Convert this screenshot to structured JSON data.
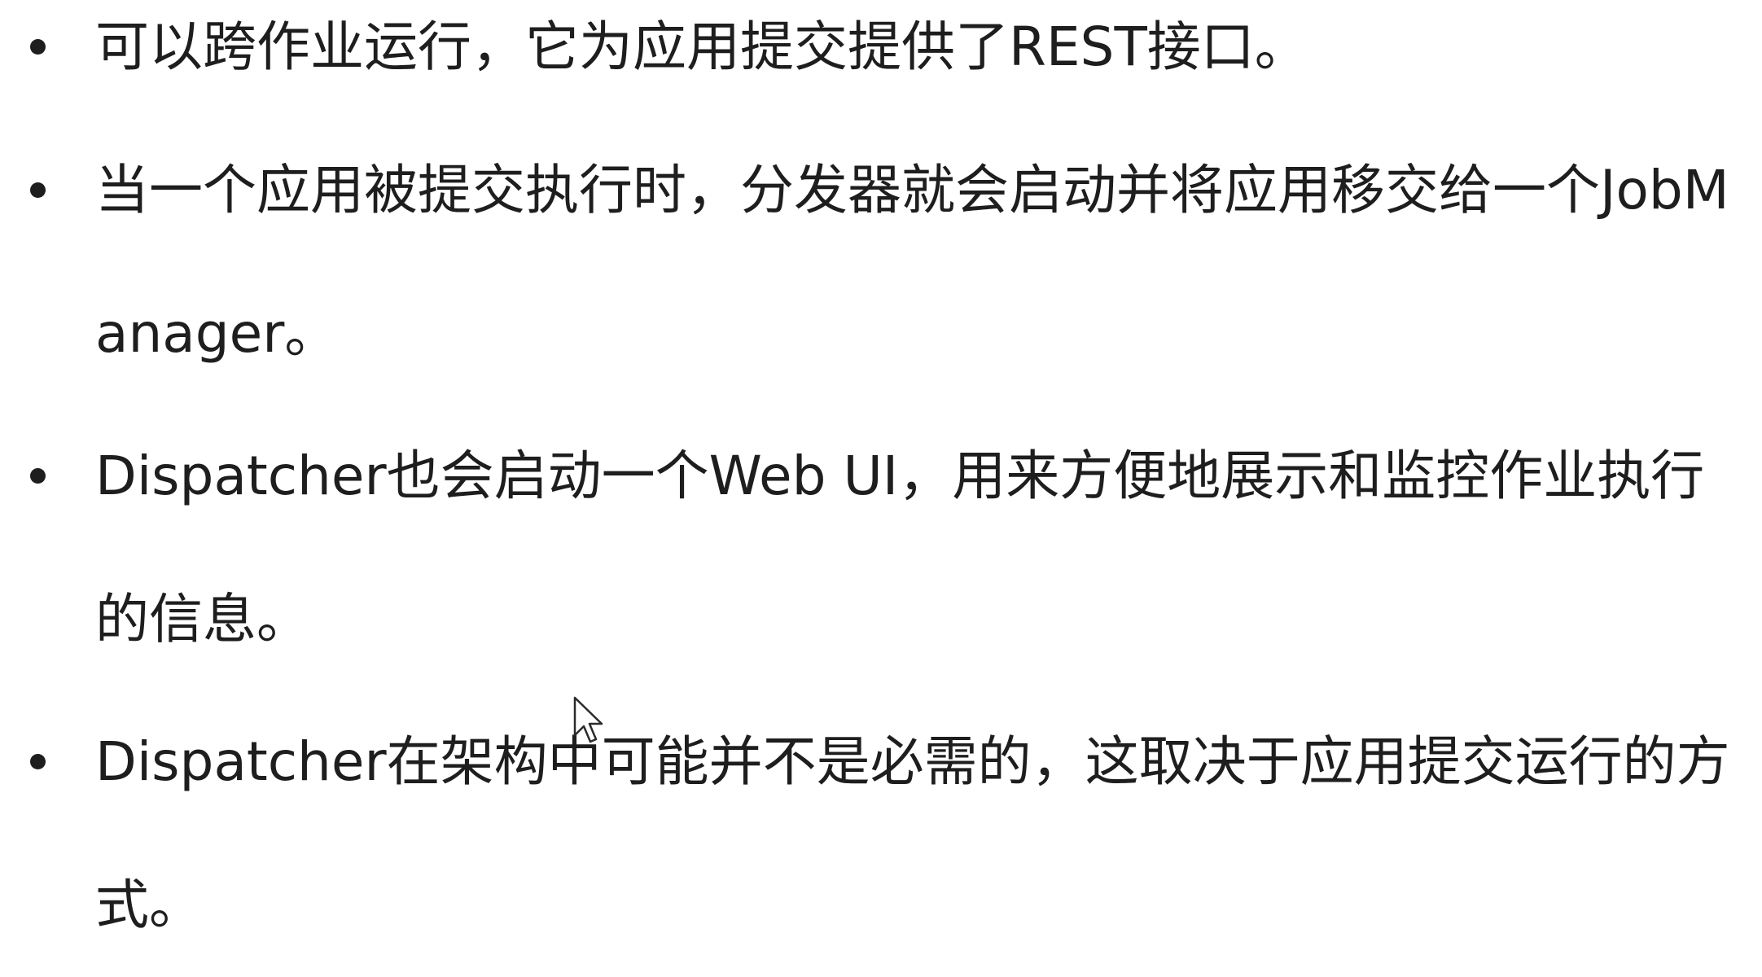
{
  "bullets": [
    {
      "text": "可以跨作业运行，它为应用提交提供了REST接口。"
    },
    {
      "text": "当一个应用被提交执行时，分发器就会启动并将应用移交给一个JobManager。"
    },
    {
      "text": "Dispatcher也会启动一个Web UI，用来方便地展示和监控作业执行的信息。"
    },
    {
      "text": "Dispatcher在架构中可能并不是必需的，这取决于应用提交运行的方式。"
    }
  ],
  "icons": {
    "cursor": "mouse-pointer-icon"
  }
}
